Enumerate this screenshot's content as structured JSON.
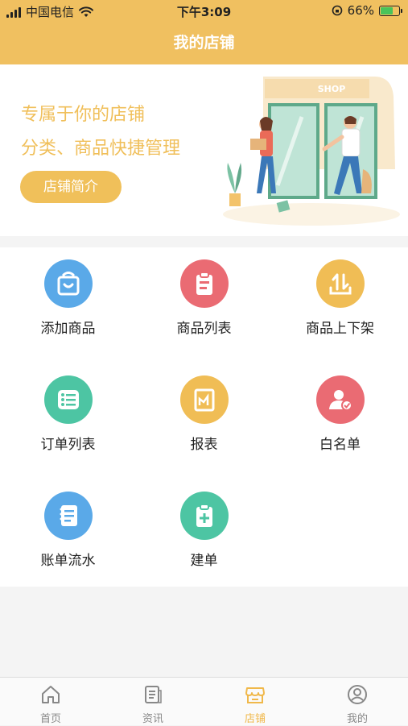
{
  "status_bar": {
    "carrier": "中国电信",
    "time": "下午3:09",
    "battery": "66%",
    "battery_level": 0.66
  },
  "header": {
    "title": "我的店铺"
  },
  "banner": {
    "line1": "专属于你的店铺",
    "line2": "分类、商品快捷管理",
    "intro_button": "店铺简介",
    "shop_sign": "SHOP"
  },
  "menu": [
    {
      "label": "添加商品",
      "icon": "shopping-bag-icon",
      "color": "#5aa9e8"
    },
    {
      "label": "商品列表",
      "icon": "clipboard-list-icon",
      "color": "#ea6b73"
    },
    {
      "label": "商品上下架",
      "icon": "upload-download-icon",
      "color": "#f0bd55"
    },
    {
      "label": "订单列表",
      "icon": "list-icon",
      "color": "#4dc5a3"
    },
    {
      "label": "报表",
      "icon": "report-chart-icon",
      "color": "#f0bd55"
    },
    {
      "label": "白名单",
      "icon": "user-check-icon",
      "color": "#ea6b73"
    },
    {
      "label": "账单流水",
      "icon": "bill-icon",
      "color": "#5aa9e8"
    },
    {
      "label": "建单",
      "icon": "create-order-icon",
      "color": "#4dc5a3"
    }
  ],
  "tabbar": [
    {
      "label": "首页",
      "icon": "home-icon"
    },
    {
      "label": "资讯",
      "icon": "news-icon"
    },
    {
      "label": "店铺",
      "icon": "store-icon",
      "active": true
    },
    {
      "label": "我的",
      "icon": "profile-icon"
    }
  ],
  "colors": {
    "header_bg": "#f0c060",
    "accent": "#f0bf5a",
    "active_tab": "#f0b84a"
  }
}
